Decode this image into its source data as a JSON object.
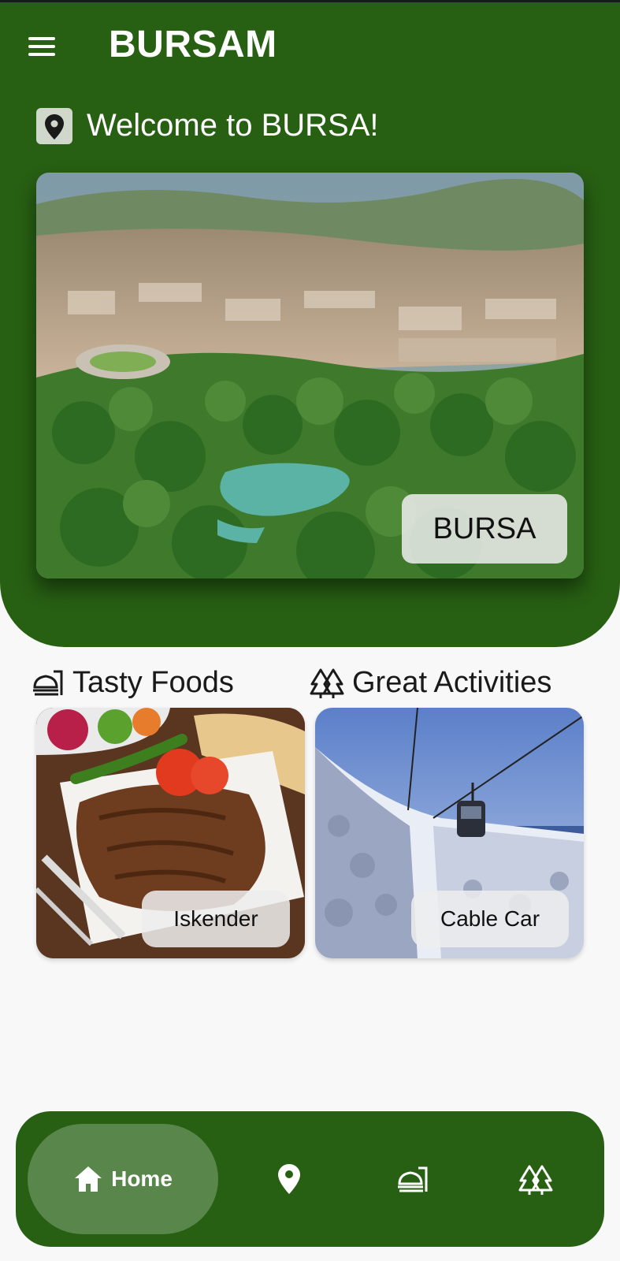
{
  "app": {
    "title": "BURSAM"
  },
  "header": {
    "welcome_text": "Welcome to BURSA!",
    "hero_label": "BURSA"
  },
  "sections": {
    "foods": {
      "title": "Tasty Foods",
      "cards": [
        {
          "label": "Iskender"
        }
      ]
    },
    "activities": {
      "title": "Great Activities",
      "cards": [
        {
          "label": "Cable Car"
        }
      ]
    }
  },
  "bottom_nav": {
    "items": [
      {
        "label": "Home",
        "icon": "home-icon",
        "active": true
      },
      {
        "label": "",
        "icon": "location-pin-icon"
      },
      {
        "label": "",
        "icon": "food-icon"
      },
      {
        "label": "",
        "icon": "trees-icon"
      }
    ]
  },
  "colors": {
    "primary_green": "#275f13",
    "active_nav": "#58864b",
    "background": "#f8f8f9"
  }
}
